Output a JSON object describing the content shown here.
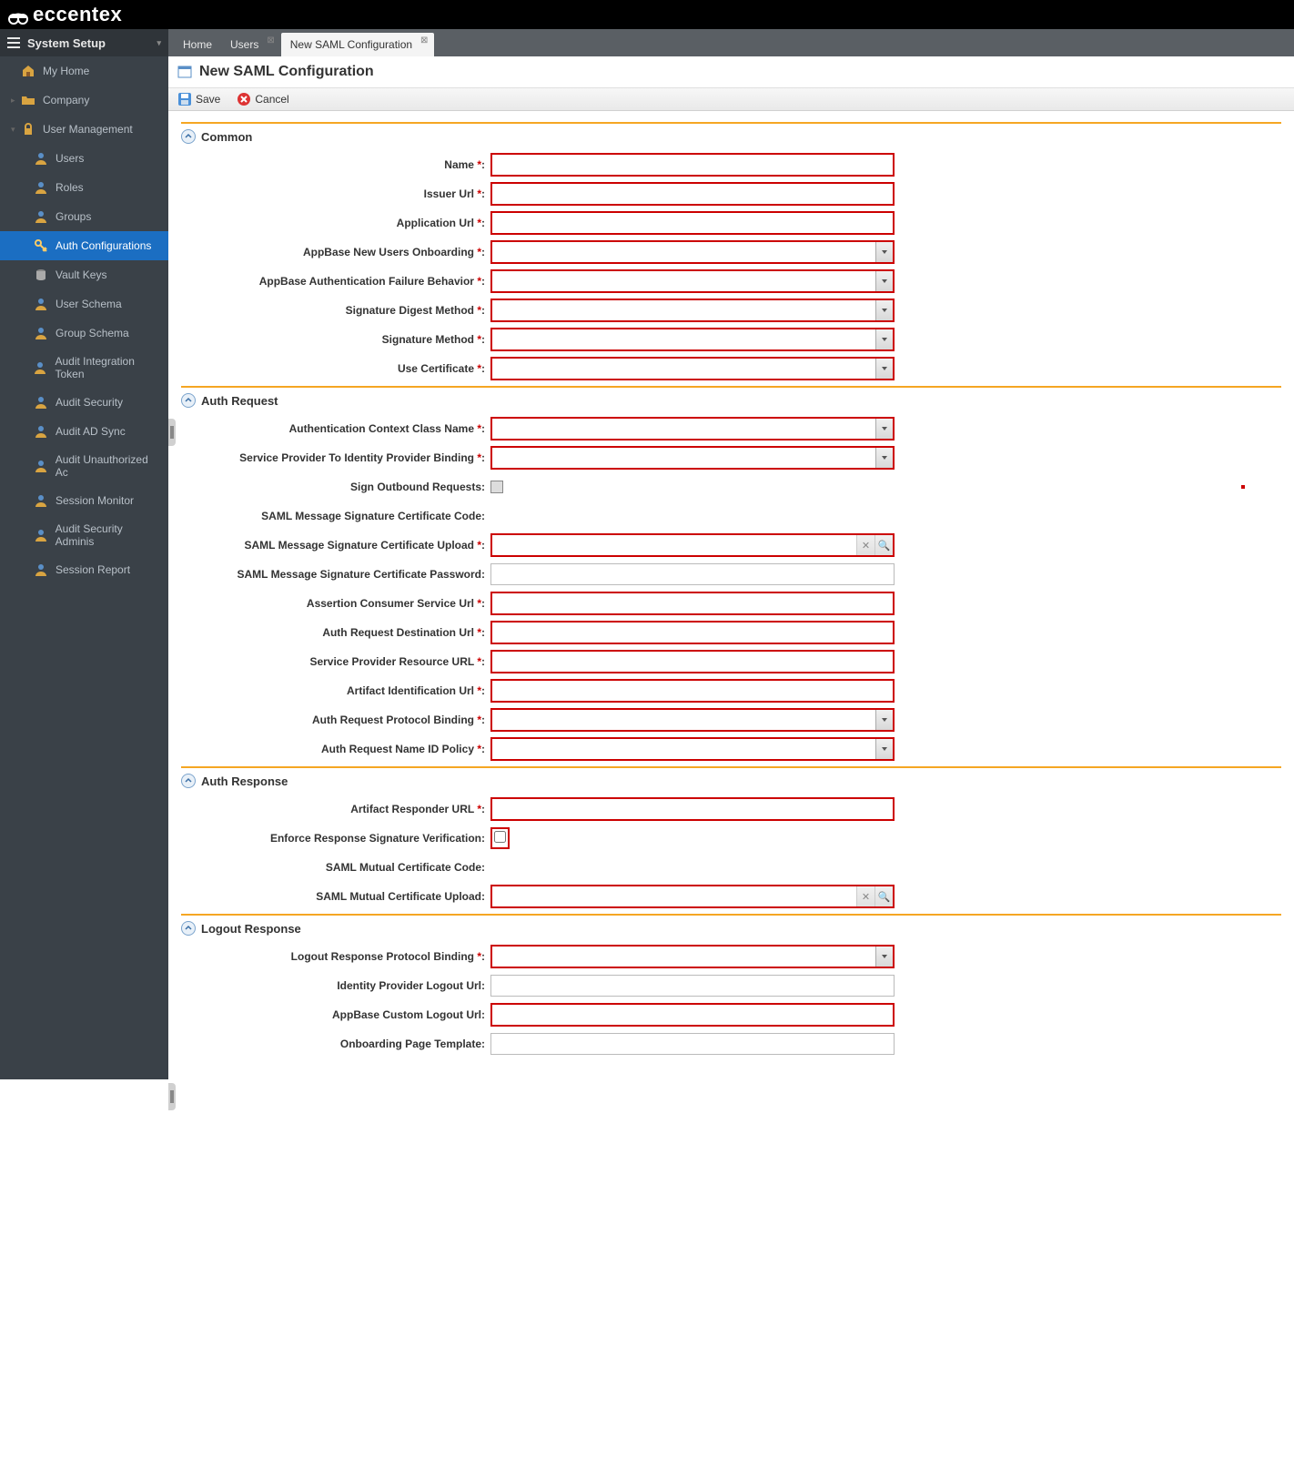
{
  "brand": "eccentex",
  "sidebar": {
    "header": "System Setup",
    "items": [
      {
        "label": "My Home",
        "icon": "home",
        "level": 1
      },
      {
        "label": "Company",
        "icon": "folder",
        "level": 1,
        "tree": "▸"
      },
      {
        "label": "User Management",
        "icon": "lock",
        "level": 1,
        "tree": "▾"
      },
      {
        "label": "Users",
        "icon": "user",
        "level": 2
      },
      {
        "label": "Roles",
        "icon": "user",
        "level": 2
      },
      {
        "label": "Groups",
        "icon": "user",
        "level": 2
      },
      {
        "label": "Auth Configurations",
        "icon": "key",
        "level": 2,
        "active": true
      },
      {
        "label": "Vault Keys",
        "icon": "db",
        "level": 2
      },
      {
        "label": "User Schema",
        "icon": "user",
        "level": 2
      },
      {
        "label": "Group Schema",
        "icon": "user",
        "level": 2
      },
      {
        "label": "Audit Integration Token",
        "icon": "user",
        "level": 2
      },
      {
        "label": "Audit Security",
        "icon": "user",
        "level": 2
      },
      {
        "label": "Audit AD Sync",
        "icon": "user",
        "level": 2
      },
      {
        "label": "Audit Unauthorized Ac",
        "icon": "user",
        "level": 2
      },
      {
        "label": "Session Monitor",
        "icon": "user",
        "level": 2
      },
      {
        "label": "Audit Security Adminis",
        "icon": "user",
        "level": 2
      },
      {
        "label": "Session Report",
        "icon": "user",
        "level": 2
      }
    ]
  },
  "tabs": [
    {
      "label": "Home",
      "closable": false
    },
    {
      "label": "Users",
      "closable": true
    },
    {
      "label": "New SAML Configuration",
      "closable": true,
      "active": true
    }
  ],
  "page_title": "New SAML Configuration",
  "toolbar": {
    "save": "Save",
    "cancel": "Cancel"
  },
  "sections": {
    "common": {
      "title": "Common",
      "fields": [
        {
          "label": "Name",
          "required": true,
          "type": "text"
        },
        {
          "label": "Issuer Url",
          "required": true,
          "type": "text"
        },
        {
          "label": "Application Url",
          "required": true,
          "type": "text"
        },
        {
          "label": "AppBase New Users Onboarding",
          "required": true,
          "type": "select"
        },
        {
          "label": "AppBase Authentication Failure Behavior",
          "required": true,
          "type": "select"
        },
        {
          "label": "Signature Digest Method",
          "required": true,
          "type": "select"
        },
        {
          "label": "Signature Method",
          "required": true,
          "type": "select"
        },
        {
          "label": "Use Certificate",
          "required": true,
          "type": "select"
        }
      ]
    },
    "auth_request": {
      "title": "Auth Request",
      "fields": [
        {
          "label": "Authentication Context Class Name",
          "required": true,
          "type": "select"
        },
        {
          "label": "Service Provider To Identity Provider Binding",
          "required": true,
          "type": "select"
        },
        {
          "label": "Sign Outbound Requests",
          "required": false,
          "type": "checkbox",
          "red_dot": true
        },
        {
          "label": "SAML Message Signature Certificate Code",
          "required": false,
          "type": "static"
        },
        {
          "label": "SAML Message Signature Certificate Upload",
          "required": true,
          "type": "upload"
        },
        {
          "label": "SAML Message Signature Certificate Password",
          "required": false,
          "type": "text"
        },
        {
          "label": "Assertion Consumer Service Url",
          "required": true,
          "type": "text"
        },
        {
          "label": "Auth Request Destination Url",
          "required": true,
          "type": "text"
        },
        {
          "label": "Service Provider Resource URL",
          "required": true,
          "type": "text"
        },
        {
          "label": "Artifact Identification Url",
          "required": true,
          "type": "text"
        },
        {
          "label": "Auth Request Protocol Binding",
          "required": true,
          "type": "select"
        },
        {
          "label": "Auth Request Name ID Policy",
          "required": true,
          "type": "select"
        }
      ]
    },
    "auth_response": {
      "title": "Auth Response",
      "fields": [
        {
          "label": "Artifact Responder URL",
          "required": true,
          "type": "text"
        },
        {
          "label": "Enforce Response Signature Verification",
          "required": false,
          "type": "checkbox_req"
        },
        {
          "label": "SAML Mutual Certificate Code",
          "required": false,
          "type": "static"
        },
        {
          "label": "SAML Mutual Certificate Upload",
          "required": false,
          "type": "upload_req"
        }
      ]
    },
    "logout_response": {
      "title": "Logout Response",
      "fields": [
        {
          "label": "Logout Response Protocol Binding",
          "required": true,
          "type": "select"
        },
        {
          "label": "Identity Provider Logout Url",
          "required": false,
          "type": "text"
        },
        {
          "label": "AppBase Custom Logout Url",
          "required": false,
          "type": "text_req"
        },
        {
          "label": "Onboarding Page Template",
          "required": false,
          "type": "text"
        }
      ]
    }
  }
}
